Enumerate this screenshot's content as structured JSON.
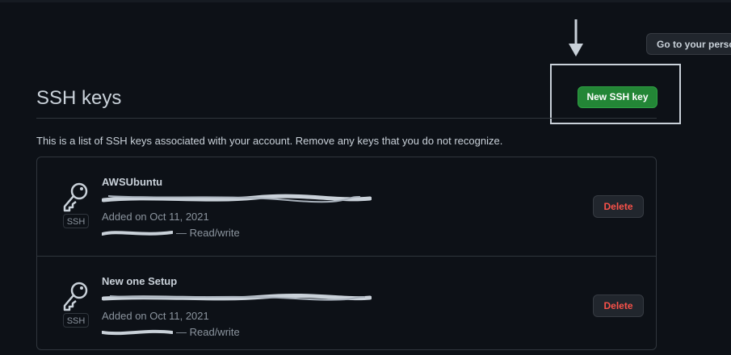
{
  "header": {
    "goto_profile_label": "Go to your personal profile"
  },
  "page": {
    "title": "SSH keys",
    "new_key_label": "New SSH key",
    "description": "This is a list of SSH keys associated with your account. Remove any keys that you do not recognize."
  },
  "keys": [
    {
      "name": "AWSUbuntu",
      "type_badge": "SSH",
      "added": "Added on Oct 11, 2021",
      "access": "— Read/write",
      "delete_label": "Delete"
    },
    {
      "name": "New one Setup",
      "type_badge": "SSH",
      "added": "Added on Oct 11, 2021",
      "access": "— Read/write",
      "delete_label": "Delete"
    }
  ],
  "colors": {
    "background": "#0d1117",
    "primary_button": "#238636",
    "danger_text": "#f85149",
    "annotation": "#c9d1d9"
  },
  "icons": {
    "key": "key-icon",
    "annotation_arrow": "arrow-down-icon"
  }
}
